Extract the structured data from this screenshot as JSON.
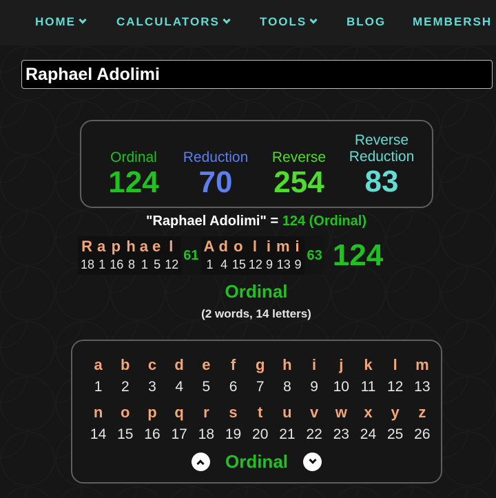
{
  "nav": {
    "items": [
      {
        "label": "HOME",
        "dropdown": true
      },
      {
        "label": "CALCULATORS",
        "dropdown": true
      },
      {
        "label": "TOOLS",
        "dropdown": true
      },
      {
        "label": "BLOG",
        "dropdown": false
      },
      {
        "label": "MEMBERSH",
        "dropdown": false
      }
    ]
  },
  "search": {
    "value": "Raphael Adolimi"
  },
  "summary": {
    "ciphers": [
      {
        "label": "Ordinal",
        "value": "124",
        "color": "#21c121"
      },
      {
        "label": "Reduction",
        "value": "70",
        "color": "#5c7ef0"
      },
      {
        "label": "Reverse",
        "value": "254",
        "color": "#4fdc2c"
      },
      {
        "label": "Reverse Reduction",
        "value": "83",
        "color": "#63dcd4"
      }
    ]
  },
  "result": {
    "phrase": "\"Raphael Adolimi\"",
    "equals": " = ",
    "value_text": "124 (Ordinal)"
  },
  "breakdown": {
    "words": [
      {
        "letters": [
          "R",
          "a",
          "p",
          "h",
          "a",
          "e",
          "l"
        ],
        "values": [
          "18",
          "1",
          "16",
          "8",
          "1",
          "5",
          "12"
        ],
        "total": "61"
      },
      {
        "letters": [
          "A",
          "d",
          "o",
          "l",
          "i",
          "m",
          "i"
        ],
        "values": [
          "1",
          "4",
          "15",
          "12",
          "9",
          "13",
          "9"
        ],
        "total": "63"
      }
    ],
    "grand_total": "124",
    "cipher_name": "Ordinal",
    "counts": "(2 words, 14 letters)"
  },
  "alphabet": {
    "rows": [
      {
        "letters": [
          "a",
          "b",
          "c",
          "d",
          "e",
          "f",
          "g",
          "h",
          "i",
          "j",
          "k",
          "l",
          "m"
        ],
        "values": [
          "1",
          "2",
          "3",
          "4",
          "5",
          "6",
          "7",
          "8",
          "9",
          "10",
          "11",
          "12",
          "13"
        ]
      },
      {
        "letters": [
          "n",
          "o",
          "p",
          "q",
          "r",
          "s",
          "t",
          "u",
          "v",
          "w",
          "x",
          "y",
          "z"
        ],
        "values": [
          "14",
          "15",
          "16",
          "17",
          "18",
          "19",
          "20",
          "21",
          "22",
          "23",
          "24",
          "25",
          "26"
        ]
      }
    ],
    "cipher_label": "Ordinal",
    "prev_icon": "chevron-up-icon",
    "next_icon": "chevron-down-icon"
  },
  "colors": {
    "nav_text": "#63dcd4",
    "letter": "#f2a77a",
    "ordinal_green": "#21c121"
  }
}
